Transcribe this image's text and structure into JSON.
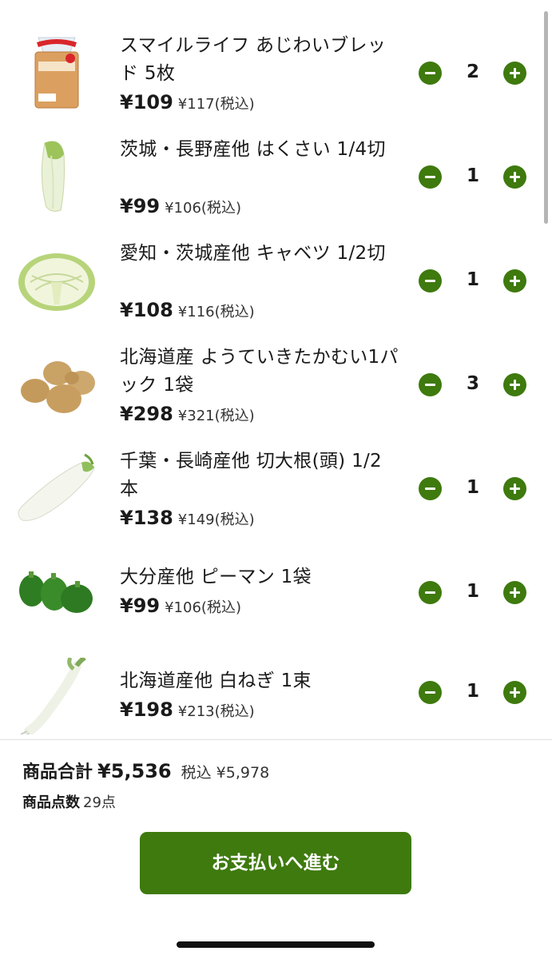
{
  "cart": {
    "items": [
      {
        "name": "スマイルライフ あじわいブレッド 5枚",
        "price": "¥109",
        "tax_price": "¥117(税込)",
        "quantity": "2",
        "image": "bread-image"
      },
      {
        "name": "茨城・長野産他 はくさい 1/4切",
        "price": "¥99",
        "tax_price": "¥106(税込)",
        "quantity": "1",
        "image": "napa-cabbage-image"
      },
      {
        "name": "愛知・茨城産他 キャベツ 1/2切",
        "price": "¥108",
        "tax_price": "¥116(税込)",
        "quantity": "1",
        "image": "cabbage-image"
      },
      {
        "name": "北海道産 ようていきたかむい1パック 1袋",
        "price": "¥298",
        "tax_price": "¥321(税込)",
        "quantity": "3",
        "image": "potato-image"
      },
      {
        "name": "千葉・長崎産他 切大根(頭) 1/2本",
        "price": "¥138",
        "tax_price": "¥149(税込)",
        "quantity": "1",
        "image": "daikon-image"
      },
      {
        "name": "大分産他 ピーマン 1袋",
        "price": "¥99",
        "tax_price": "¥106(税込)",
        "quantity": "1",
        "image": "green-pepper-image"
      },
      {
        "name": "北海道産他 白ねぎ 1束",
        "price": "¥198",
        "tax_price": "¥213(税込)",
        "quantity": "1",
        "image": "leek-image"
      }
    ]
  },
  "summary": {
    "total_label": "商品合計",
    "total_value": "¥5,536",
    "tax_label": "税込 ¥5,978",
    "count_label": "商品点数",
    "count_value": "29点"
  },
  "checkout": {
    "button_label": "お支払いへ進む"
  },
  "colors": {
    "accent": "#3e7a0e"
  },
  "icons": {
    "decrement": "minus-circle-icon",
    "increment": "plus-circle-icon"
  }
}
